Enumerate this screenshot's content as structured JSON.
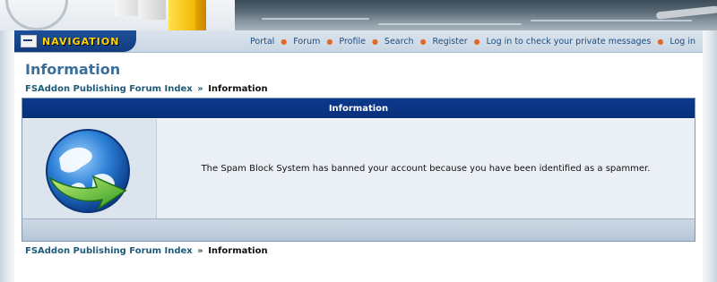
{
  "navigation": {
    "badge_label": "NAVIGATION",
    "links": [
      "Portal",
      "Forum",
      "Profile",
      "Search",
      "Register",
      "Log in to check your private messages",
      "Log in"
    ],
    "separator": "●"
  },
  "page": {
    "title": "Information"
  },
  "breadcrumb": {
    "index_link": "FSAddon Publishing Forum Index",
    "separator": "»",
    "current": "Information"
  },
  "panel": {
    "header": "Information",
    "message": "The Spam Block System has banned your account because you have been identified as a spammer.",
    "icon": "globe-arrow-icon"
  },
  "colors": {
    "nav_badge": "#123b7c",
    "nav_title": "#ffd400",
    "panel_header": "#0d3a8c",
    "link": "#1f5a78",
    "page_title": "#3b6f9b"
  }
}
